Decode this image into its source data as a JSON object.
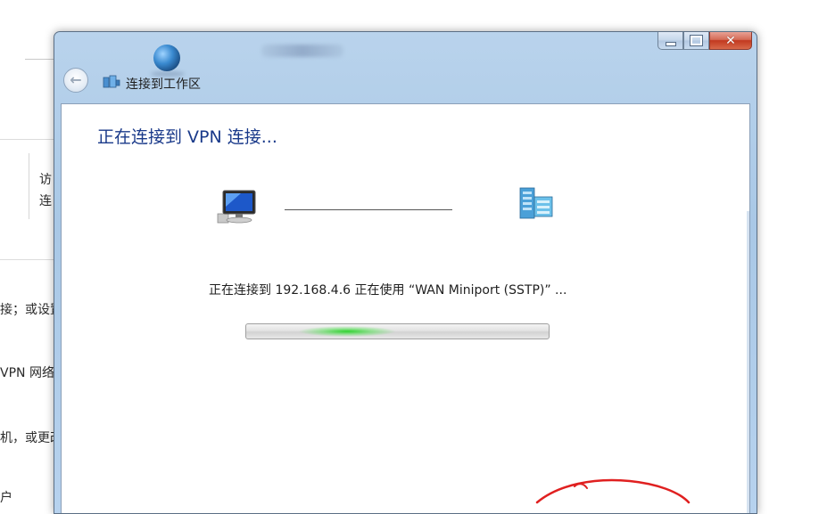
{
  "background_window": {
    "text_fragments": [
      "访",
      "连",
      "接；或设置",
      "VPN 网络",
      "机，或更改",
      "户"
    ]
  },
  "dialog": {
    "nav_title": "连接到工作区",
    "heading": "正在连接到 VPN 连接...",
    "status_text": "正在连接到 192.168.4.6 正在使用 “WAN Miniport (SSTP)” ...",
    "progress_mode": "indeterminate",
    "caption_buttons": {
      "minimize": "",
      "maximize": "",
      "close": "✕"
    },
    "icons": {
      "back": "back-arrow-icon",
      "network": "network-connection-icon",
      "computer": "computer-monitor-icon",
      "server": "server-icon",
      "globe": "globe-icon"
    }
  },
  "colors": {
    "heading": "#1a3a8a",
    "progress_glow": "#28d228",
    "annotation": "#e02020"
  }
}
